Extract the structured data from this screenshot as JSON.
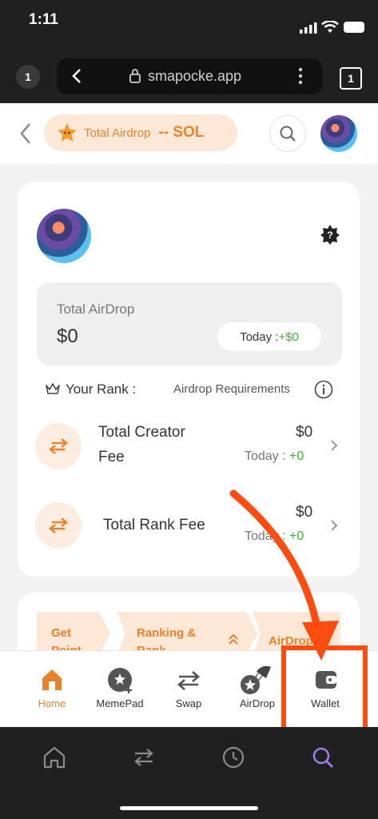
{
  "status_bar": {
    "time": "1:11"
  },
  "browser": {
    "tab_count_left": "1",
    "url": "smapocke.app",
    "tab_count_right": "1"
  },
  "header": {
    "airdrop_label": "Total Airdrop",
    "airdrop_value": "-- SOL"
  },
  "airdrop_card": {
    "title": "Total AirDrop",
    "amount": "$0",
    "today_label": "Today : ",
    "today_value": "+$0",
    "rank_label": "Your Rank :",
    "requirements_label": "Airdrop Requirements",
    "rows": [
      {
        "label_line1": "Total Creator",
        "label_line2": "Fee",
        "value": "$0",
        "today_label": "Today : ",
        "today_value": "+0"
      },
      {
        "label_line1": "Total Rank Fee",
        "label_line2": "",
        "value": "$0",
        "today_label": "Today : ",
        "today_value": "+0"
      }
    ]
  },
  "section_tabs": [
    "Get Point",
    "Ranking & Rank",
    "AirDrop"
  ],
  "bottom_nav": [
    {
      "label": "Home",
      "icon": "home-icon",
      "active": true
    },
    {
      "label": "MemePad",
      "icon": "memepad-icon",
      "active": false
    },
    {
      "label": "Swap",
      "icon": "swap-icon",
      "active": false
    },
    {
      "label": "AirDrop",
      "icon": "airdrop-icon",
      "active": false
    },
    {
      "label": "Wallet",
      "icon": "wallet-icon",
      "active": false
    }
  ],
  "colors": {
    "accent": "#e8832b",
    "annotation": "#ff4d12",
    "green": "#4aa93c",
    "active_browser": "#9b7be8"
  }
}
